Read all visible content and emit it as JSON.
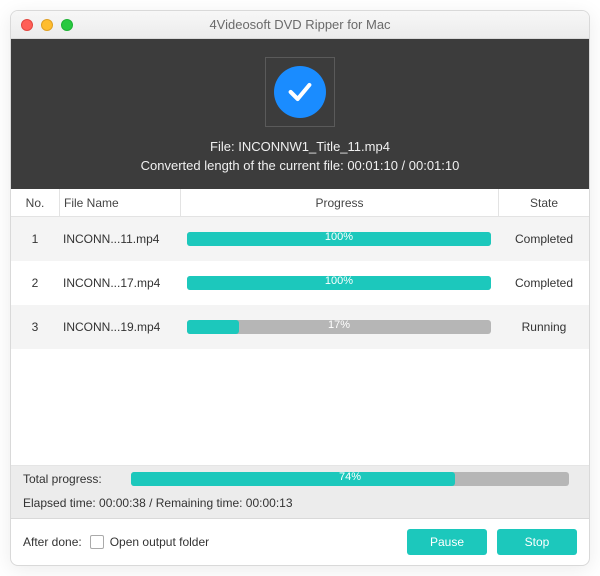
{
  "window": {
    "title": "4Videosoft DVD Ripper for Mac"
  },
  "hero": {
    "file_line": "File: INCONNW1_Title_11.mp4",
    "converted_line": "Converted length of the current file: 00:01:10 / 00:01:10"
  },
  "columns": {
    "no": "No.",
    "file": "File Name",
    "progress": "Progress",
    "state": "State"
  },
  "rows": [
    {
      "no": "1",
      "file": "INCONN...11.mp4",
      "percent": 100,
      "percent_label": "100%",
      "state": "Completed"
    },
    {
      "no": "2",
      "file": "INCONN...17.mp4",
      "percent": 100,
      "percent_label": "100%",
      "state": "Completed"
    },
    {
      "no": "3",
      "file": "INCONN...19.mp4",
      "percent": 17,
      "percent_label": "17%",
      "state": "Running"
    }
  ],
  "total": {
    "label": "Total progress:",
    "percent": 74,
    "percent_label": "74%"
  },
  "time_line": "Elapsed time: 00:00:38 / Remaining time: 00:00:13",
  "after_done": {
    "label": "After done:",
    "checkbox_label": "Open output folder",
    "checked": false
  },
  "buttons": {
    "pause": "Pause",
    "stop": "Stop"
  },
  "colors": {
    "accent": "#1cc8bc",
    "check": "#1a8cff"
  }
}
